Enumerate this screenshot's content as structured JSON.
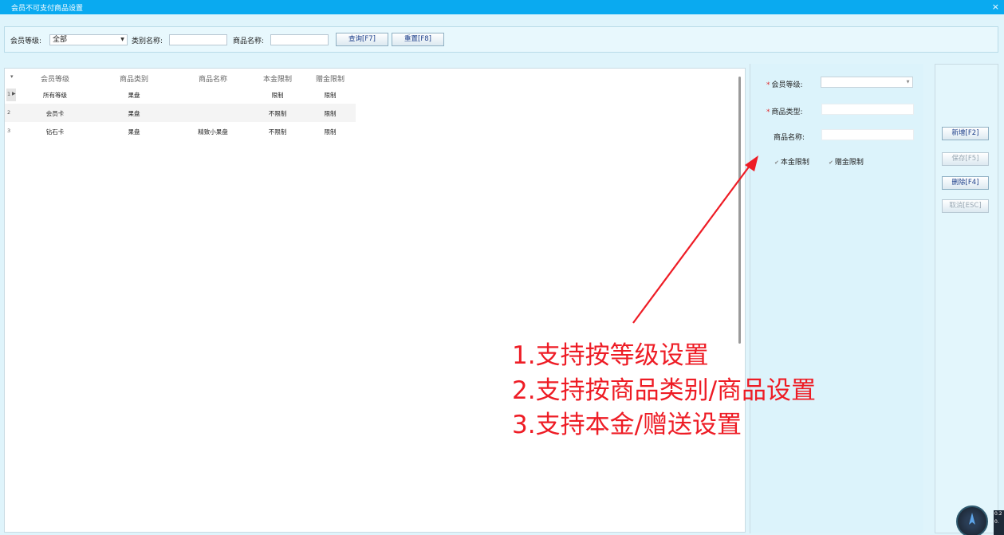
{
  "window": {
    "title": "会员不可支付商品设置",
    "close": "×"
  },
  "filters": {
    "member_level_label": "会员等级:",
    "member_level_value": "全部",
    "category_label": "类别名称:",
    "category_value": "",
    "product_label": "商品名称:",
    "product_value": "",
    "query_button": "查询[F7]",
    "reset_button": "重置[F8]"
  },
  "table": {
    "sort_marker": "▾",
    "headers": [
      "会员等级",
      "商品类别",
      "商品名称",
      "本金限制",
      "赠金限制"
    ],
    "rows": [
      {
        "idx": "1",
        "level": "所有等级",
        "category": "果盘",
        "product": "",
        "principal": "限制",
        "bonus": "限制"
      },
      {
        "idx": "2",
        "level": "会员卡",
        "category": "果盘",
        "product": "",
        "principal": "不限制",
        "bonus": "限制"
      },
      {
        "idx": "3",
        "level": "钻石卡",
        "category": "果盘",
        "product": "精致小果盘",
        "principal": "不限制",
        "bonus": "限制"
      }
    ]
  },
  "form": {
    "required_mark": "*",
    "member_level_label": "会员等级:",
    "product_type_label": "商品类型:",
    "product_name_label": "商品名称:",
    "principal_checkbox": "本金限制",
    "bonus_checkbox": "赠金限制"
  },
  "actions": {
    "add": "新增[F2]",
    "save": "保存[F5]",
    "delete": "删除[F4]",
    "cancel": "取消[ESC]"
  },
  "annotation": {
    "line1": "1.支持按等级设置",
    "line2": "2.支持按商品类别/商品设置",
    "line3": "3.支持本金/赠送设置",
    "color": "#ee1c25"
  },
  "widget": {
    "text_top": "0.2",
    "text_bottom": "0."
  },
  "colors": {
    "titlebar": "#0aaaf0",
    "panel_bg": "#dff4fb",
    "required": "#e0292c"
  }
}
